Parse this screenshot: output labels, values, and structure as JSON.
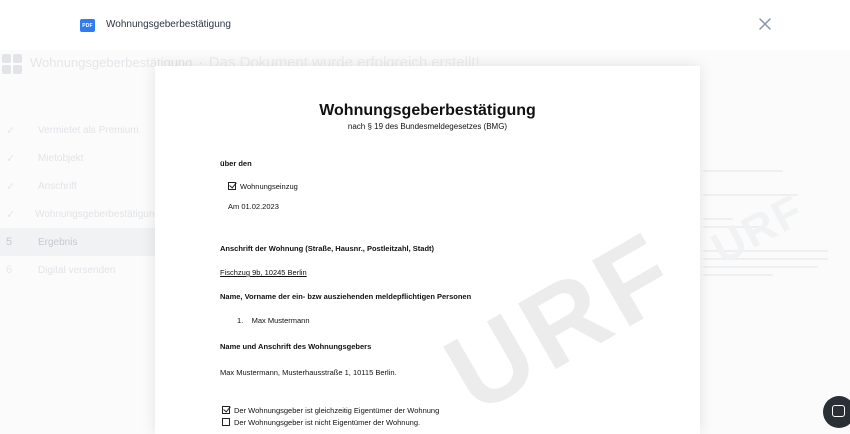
{
  "background": {
    "app_title": "Wohnungsgeberbestätigung",
    "header_message": "Das Dokument wurde erfolgreich erstellt!",
    "steps": [
      {
        "mark": "✓",
        "label": "Vermietet als Premium"
      },
      {
        "mark": "✓",
        "label": "Mietobjekt"
      },
      {
        "mark": "✓",
        "label": "Anschrift"
      },
      {
        "mark": "✓",
        "label": "Wohnungsgeberbestätigung"
      },
      {
        "mark": "5",
        "label": "Ergebnis"
      },
      {
        "mark": "6",
        "label": "Digital versenden"
      }
    ],
    "right_watermark": "URF"
  },
  "modal": {
    "file_icon_label": "PDF",
    "file_title": "Wohnungsgeberbestätigung",
    "close_icon": "close-icon"
  },
  "document": {
    "title": "Wohnungsgeberbestätigung",
    "subtitle": "nach § 19 des Bundesmeldegesetzes (BMG)",
    "ueber_den_label": "über den",
    "move_type": "Wohnungseinzug",
    "date_line": "Am 01.02.2023",
    "address_label": "Anschrift der Wohnung (Straße, Hausnr., Postleitzahl, Stadt)",
    "address_value": "Fischzug 9b, 10245 Berlin",
    "persons_label": "Name, Vorname der ein- bzw ausziehenden meldepflichtigen Personen",
    "persons": [
      "1.    Max Mustermann"
    ],
    "landlord_label": "Name und Anschrift des Wohnungsgebers",
    "landlord_value": "Max Mustermann, Musterhausstraße 1, 10115 Berlin.",
    "owner_options": [
      {
        "label": "Der Wohnungsgeber ist gleichzeitig Eigentümer der Wohnung",
        "checked": true
      },
      {
        "label": "Der Wohnungsgeber ist nicht Eigentümer der Wohnung.",
        "checked": false
      }
    ],
    "watermark": "URF"
  },
  "colors": {
    "accent": "#2f7bf5",
    "close_icon": "#8a93a6",
    "chat_button": "#2b2f36"
  },
  "chat": {
    "icon": "chat-bubble-icon"
  }
}
